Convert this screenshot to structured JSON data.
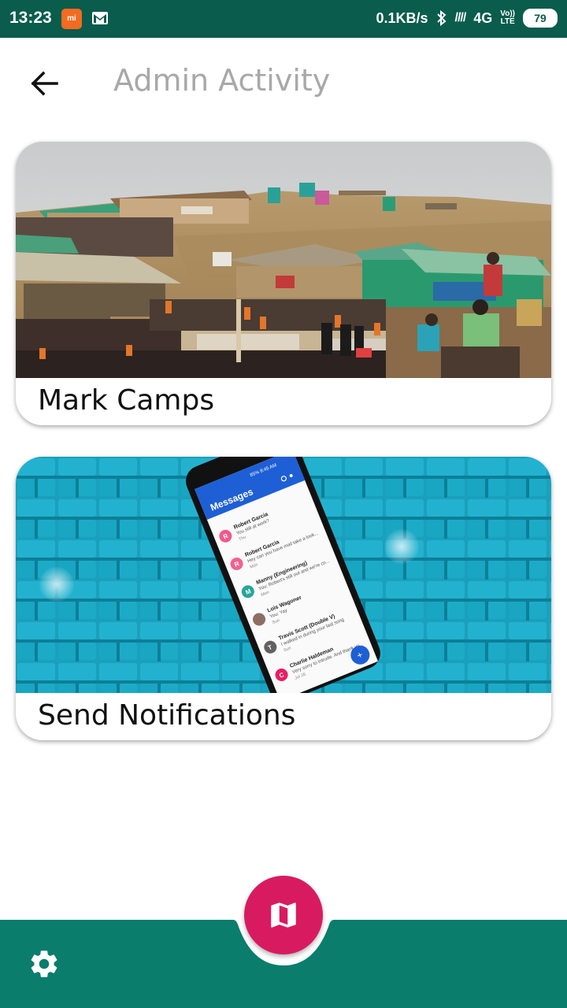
{
  "status_bar": {
    "time": "13:23",
    "mi_badge": "mi",
    "network_speed": "0.1KB/s",
    "network_type": "4G",
    "volte_line1": "Vo))",
    "volte_line2": "LTE",
    "battery": "79"
  },
  "header": {
    "title": "Admin Activity"
  },
  "cards": [
    {
      "label": "Mark Camps",
      "image": "camp-crowd-photo"
    },
    {
      "label": "Send Notifications",
      "image": "phone-messages-photo"
    }
  ],
  "phone_screen": {
    "app_title": "Messages",
    "status_text": "85% 8:45 AM",
    "messages": [
      {
        "initial": "R",
        "name": "Robert Garcia",
        "preview": "You still at work?",
        "time": "Thu",
        "color": "#ef5a8a"
      },
      {
        "initial": "R",
        "name": "Robert Garcia",
        "preview": "Hey can you have mail take a look...",
        "time": "Mon",
        "color": "#f06292"
      },
      {
        "initial": "M",
        "name": "Manny (Engineering)",
        "preview": "You: Robert's still out and we're co...",
        "time": "Mon",
        "color": "#26a69a"
      },
      {
        "initial": "",
        "name": "Lois Wagoner",
        "preview": "You: Yay",
        "time": "Sun",
        "color": "#8d6e63"
      },
      {
        "initial": "T",
        "name": "Travis Scott (Double V)",
        "preview": "I walked in during your last song",
        "time": "Sun",
        "color": "#616161"
      },
      {
        "initial": "C",
        "name": "Charlie Haldeman",
        "preview": "Very sorry to intrude. And thank yo...",
        "time": "Jul 26",
        "color": "#e91e63"
      }
    ]
  },
  "nav": {
    "fab_icon": "map-icon",
    "settings_icon": "gear-icon"
  },
  "colors": {
    "status_bar": "#0a5c4c",
    "bottom_bar": "#0a7d6c",
    "fab": "#d81b60",
    "title": "#a8a8a8"
  }
}
